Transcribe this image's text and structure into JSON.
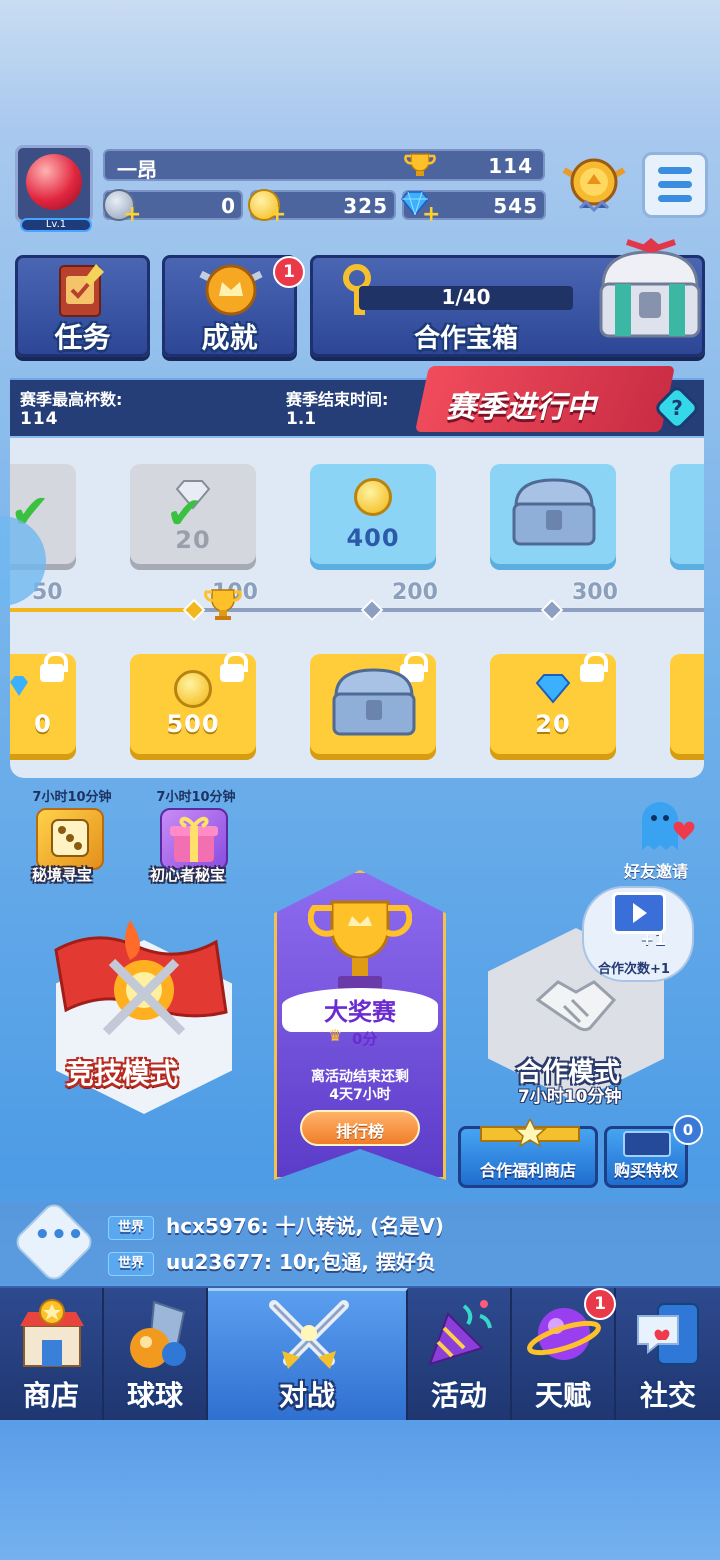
{
  "player": {
    "name": "一昂",
    "level": "Lv.1",
    "trophies": "114",
    "currency1": "0",
    "coins": "325",
    "gems": "545"
  },
  "top_cards": {
    "tasks": "任务",
    "achievements": "成就",
    "achievements_badge": "1",
    "coop_chest_progress": "1/40",
    "coop_chest": "合作宝箱"
  },
  "season": {
    "best_label": "赛季最高杯数:",
    "best_value": "114",
    "end_label": "赛季结束时间:",
    "end_value": "1.1",
    "status": "赛季进行中",
    "help": "?"
  },
  "track": {
    "ticks": [
      "50",
      "100",
      "200",
      "300"
    ],
    "current_progress_value": 100,
    "top_rewards": [
      {
        "value": ""
      },
      {
        "value": "20"
      },
      {
        "value": "400"
      },
      {
        "value": ""
      }
    ],
    "bottom_rewards": [
      {
        "value": "0"
      },
      {
        "value": "500"
      },
      {
        "value": ""
      },
      {
        "value": "20"
      }
    ]
  },
  "events": [
    {
      "time": "7小时10分钟",
      "label": "秘境寻宝"
    },
    {
      "time": "7小时10分钟",
      "label": "初心者秘宝"
    }
  ],
  "friend_invite": "好友邀请",
  "modes": {
    "competitive": "竞技模式",
    "grand_prix": {
      "title": "大奖赛",
      "score": "0分",
      "countdown_line1": "离活动结束还剩",
      "countdown_line2": "4天7小时",
      "leaderboard": "排行榜"
    },
    "coop": {
      "title": "合作模式",
      "time": "7小时10分钟",
      "video_bonus": "+1",
      "video_label": "合作次数+1"
    }
  },
  "shop_buttons": {
    "coop_shop": "合作福利商店",
    "buy_privilege": "购买特权",
    "privilege_badge": "0"
  },
  "chat": [
    {
      "channel": "世界",
      "text": "hcx5976: 十八转说, (名是V)"
    },
    {
      "channel": "世界",
      "text": "uu23677: 10r,包通, 摆好负"
    }
  ],
  "nav": [
    {
      "label": "商店"
    },
    {
      "label": "球球"
    },
    {
      "label": "对战"
    },
    {
      "label": "活动"
    },
    {
      "label": "天赋",
      "badge": "1"
    },
    {
      "label": "社交"
    }
  ],
  "colors": {
    "accent": "#3b8ddf",
    "gold": "#ffcd3a",
    "badge_red": "#ea3a4a"
  }
}
